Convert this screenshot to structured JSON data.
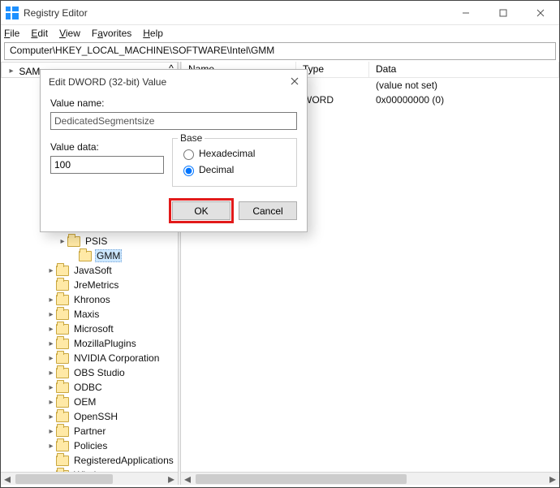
{
  "window": {
    "title": "Registry Editor"
  },
  "menu": {
    "file": "File",
    "edit": "Edit",
    "view": "View",
    "favorites": "Favorites",
    "help": "Help"
  },
  "addressbar": {
    "path": "Computer\\HKEY_LOCAL_MACHINE\\SOFTWARE\\Intel\\GMM"
  },
  "tree": {
    "header_label": "SAM",
    "selected": "GMM",
    "items": [
      {
        "label": "PSIS",
        "depth": 5,
        "expandable": true,
        "sub": false
      },
      {
        "label": "GMM",
        "depth": 5,
        "expandable": false,
        "sub": true,
        "selected": true
      },
      {
        "label": "JavaSoft",
        "depth": 4,
        "expandable": true
      },
      {
        "label": "JreMetrics",
        "depth": 4,
        "expandable": false
      },
      {
        "label": "Khronos",
        "depth": 4,
        "expandable": true
      },
      {
        "label": "Maxis",
        "depth": 4,
        "expandable": true
      },
      {
        "label": "Microsoft",
        "depth": 4,
        "expandable": true
      },
      {
        "label": "MozillaPlugins",
        "depth": 4,
        "expandable": true
      },
      {
        "label": "NVIDIA Corporation",
        "depth": 4,
        "expandable": true
      },
      {
        "label": "OBS Studio",
        "depth": 4,
        "expandable": true
      },
      {
        "label": "ODBC",
        "depth": 4,
        "expandable": true
      },
      {
        "label": "OEM",
        "depth": 4,
        "expandable": true
      },
      {
        "label": "OpenSSH",
        "depth": 4,
        "expandable": true
      },
      {
        "label": "Partner",
        "depth": 4,
        "expandable": true
      },
      {
        "label": "Policies",
        "depth": 4,
        "expandable": true
      },
      {
        "label": "RegisteredApplications",
        "depth": 4,
        "expandable": false
      },
      {
        "label": "Windows",
        "depth": 4,
        "expandable": true
      }
    ]
  },
  "list": {
    "columns": {
      "name": "Name",
      "type": "Type",
      "data": "Data"
    },
    "rows": [
      {
        "name": "",
        "type": "",
        "data": "(value not set)"
      },
      {
        "name": "",
        "type": "WORD",
        "data": "0x00000000 (0)"
      }
    ]
  },
  "dialog": {
    "title": "Edit DWORD (32-bit) Value",
    "value_name_label": "Value name:",
    "value_name": "DedicatedSegmentsize",
    "value_data_label": "Value data:",
    "value_data": "100",
    "base_label": "Base",
    "radio_hex": "Hexadecimal",
    "radio_dec": "Decimal",
    "base_selected": "Decimal",
    "ok": "OK",
    "cancel": "Cancel"
  }
}
